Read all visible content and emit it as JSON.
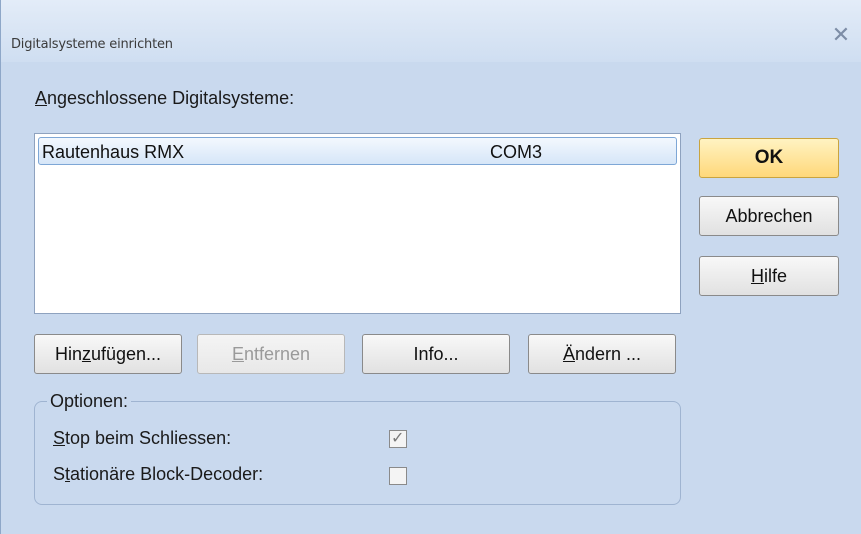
{
  "window": {
    "title": "Digitalsysteme einrichten",
    "close_glyph": "✕"
  },
  "main": {
    "list_label_prefix": "A",
    "list_label_rest": "ngeschlossene Digitalsysteme:",
    "list": [
      {
        "name": "Rautenhaus RMX",
        "port": "COM3"
      }
    ]
  },
  "buttons": {
    "ok": "OK",
    "cancel": "Abbrechen",
    "help_prefix": "",
    "help_accel": "H",
    "help_rest": "ilfe",
    "add_prefix": "Hin",
    "add_accel": "z",
    "add_rest": "ufügen...",
    "remove_prefix": "",
    "remove_accel": "E",
    "remove_rest": "ntfernen",
    "info": "Info...",
    "change_prefix": "",
    "change_accel": "Ä",
    "change_rest": "ndern ..."
  },
  "options": {
    "legend": "Optionen:",
    "stop_accel": "S",
    "stop_rest": "top beim Schliessen:",
    "stop_checked": true,
    "stationary_prefix": "S",
    "stationary_accel": "t",
    "stationary_rest": "ationäre Block-Decoder:",
    "stationary_checked": false
  }
}
